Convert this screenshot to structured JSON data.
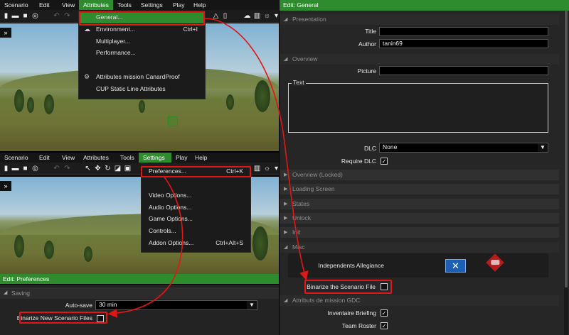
{
  "top_editor": {
    "menu": [
      "Scenario",
      "Edit",
      "View",
      "Attributes",
      "Tools",
      "Settings",
      "Play",
      "Help"
    ],
    "active_menu": "Attributes",
    "attributes_menu": [
      {
        "label": "General...",
        "shortcut": "",
        "icon": "none",
        "highlighted": true
      },
      {
        "label": "Environment...",
        "shortcut": "Ctrl+I",
        "icon": "cloud-icon",
        "highlighted": false
      },
      {
        "label": "Multiplayer...",
        "shortcut": "",
        "icon": "none",
        "highlighted": false
      },
      {
        "label": "Performance...",
        "shortcut": "",
        "icon": "none",
        "highlighted": false
      },
      {
        "label": "Attributes mission CanardProof",
        "shortcut": "",
        "icon": "gear-icon",
        "highlighted": false
      },
      {
        "label": "CUP Static Line Attributes",
        "shortcut": "",
        "icon": "none",
        "highlighted": false
      }
    ],
    "side_toggle": "»"
  },
  "bottom_editor": {
    "menu": [
      "Scenario",
      "Edit",
      "View",
      "Attributes",
      "Tools",
      "Settings",
      "Play",
      "Help"
    ],
    "active_menu": "Settings",
    "settings_menu": [
      {
        "label": "Preferences...",
        "shortcut": "Ctrl+K"
      },
      {
        "label": "Video Options...",
        "shortcut": ""
      },
      {
        "label": "Audio Options...",
        "shortcut": ""
      },
      {
        "label": "Game Options...",
        "shortcut": ""
      },
      {
        "label": "Controls...",
        "shortcut": ""
      },
      {
        "label": "Addon Options...",
        "shortcut": "Ctrl+Alt+S"
      }
    ],
    "side_toggle": "»"
  },
  "preferences": {
    "title": "Edit: Preferences",
    "section": "Saving",
    "autosave_label": "Auto-save",
    "autosave_value": "30 min",
    "binarize_label": "Binarize New Scenario Files",
    "binarize_checked": false
  },
  "general": {
    "title": "Edit: General",
    "sections": {
      "presentation": "Presentation",
      "overview": "Overview",
      "overview_locked": "Overview (Locked)",
      "loading_screen": "Loading Screen",
      "states": "States",
      "unlock": "Unlock",
      "init": "Init",
      "misc": "Misc",
      "gdc": "Attributs de mission GDC"
    },
    "title_label": "Title",
    "title_value": "",
    "author_label": "Author",
    "author_value": "tanin69",
    "picture_label": "Picture",
    "picture_value": "",
    "text_label": "Text",
    "dlc_label": "DLC",
    "dlc_value": "None",
    "require_dlc_label": "Require DLC",
    "require_dlc_checked": true,
    "independents_label": "Independents Allegiance",
    "binarize_label": "Binarize the Scenario File",
    "binarize_checked": false,
    "inventaire_label": "Inventaire Briefing",
    "inventaire_checked": true,
    "team_roster_label": "Team Roster",
    "team_roster_checked": true
  },
  "colors": {
    "accent_green": "#2e8b2e",
    "annotation_red": "#e31515",
    "blufor_blue": "#1d5fb5"
  }
}
